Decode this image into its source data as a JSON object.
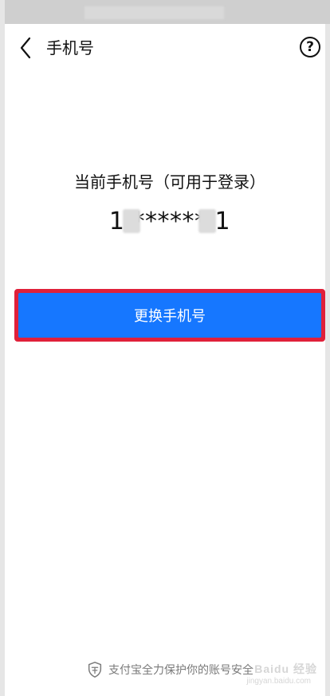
{
  "header": {
    "title": "手机号",
    "back_icon": "chevron-left-icon",
    "help_icon": "question-circle-icon",
    "help_symbol": "?"
  },
  "main": {
    "current_phone_label": "当前手机号（可用于登录）",
    "phone_masked_visible": "1  ******  1"
  },
  "actions": {
    "change_phone_label": "更换手机号"
  },
  "footer": {
    "security_text": "支付宝全力保护你的账号安全",
    "shield_icon": "shield-icon"
  },
  "watermark": {
    "line1": "Baidu 经验",
    "line2": "jingyan.baidu.com"
  },
  "colors": {
    "primary": "#1677ff",
    "highlight_outline": "#e0203a",
    "text": "#111111",
    "muted_text": "#7a7a7a"
  }
}
